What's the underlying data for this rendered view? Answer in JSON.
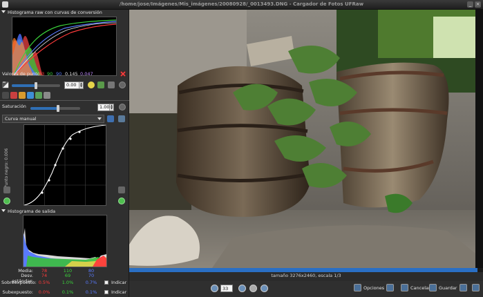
{
  "window": {
    "title": "/home/jose/Imágenes/Mis_imágenes/20080928/_0013493.DNG - Cargador de Fotos UFRaw"
  },
  "raw_histogram": {
    "title": "Histograma raw con curvas de conversión"
  },
  "point_values": {
    "label": "Valores de punto:",
    "values": [
      {
        "text": "63",
        "color": "#ff3b3b"
      },
      {
        "text": "90",
        "color": "#3bd33b"
      },
      {
        "text": "90",
        "color": "#5a7bff"
      },
      {
        "text": "0.145",
        "color": "#e6e6e6"
      },
      {
        "text": "0.047",
        "color": "#c08cff"
      }
    ]
  },
  "exposure": {
    "value": "0.00",
    "fill_fraction": 0.5
  },
  "saturation": {
    "label": "Saturación",
    "value": "1.00",
    "fill_fraction": 0.55
  },
  "curve": {
    "preset": "Curva manual",
    "black_point_label": "Punto negro: 0.006"
  },
  "output_histogram": {
    "title": "Histograma de salida"
  },
  "stats": {
    "mean": {
      "label": "Media:",
      "values": [
        "78",
        "110",
        "80"
      ]
    },
    "stddev": {
      "label": "Desv. estándar:",
      "values": [
        "74",
        "69",
        "70"
      ]
    },
    "overexposed": {
      "label": "Sobreexpuesto:",
      "values": [
        "0.5%",
        "1.0%",
        "0.7%"
      ],
      "check_label": "Indicar"
    },
    "underexposed": {
      "label": "Subexpuesto:",
      "values": [
        "0.0%",
        "0.1%",
        "0.1%"
      ],
      "check_label": "Indicar"
    },
    "colors": [
      "#ff3b3b",
      "#3bd33b",
      "#5a7bff"
    ]
  },
  "status": {
    "text": "tamaño 3276x2460, escala 1/3"
  },
  "toolbar": {
    "zoom_value": "33",
    "options_label": "Opciones",
    "cancel_label": "Cancelar",
    "save_label": "Guardar"
  }
}
